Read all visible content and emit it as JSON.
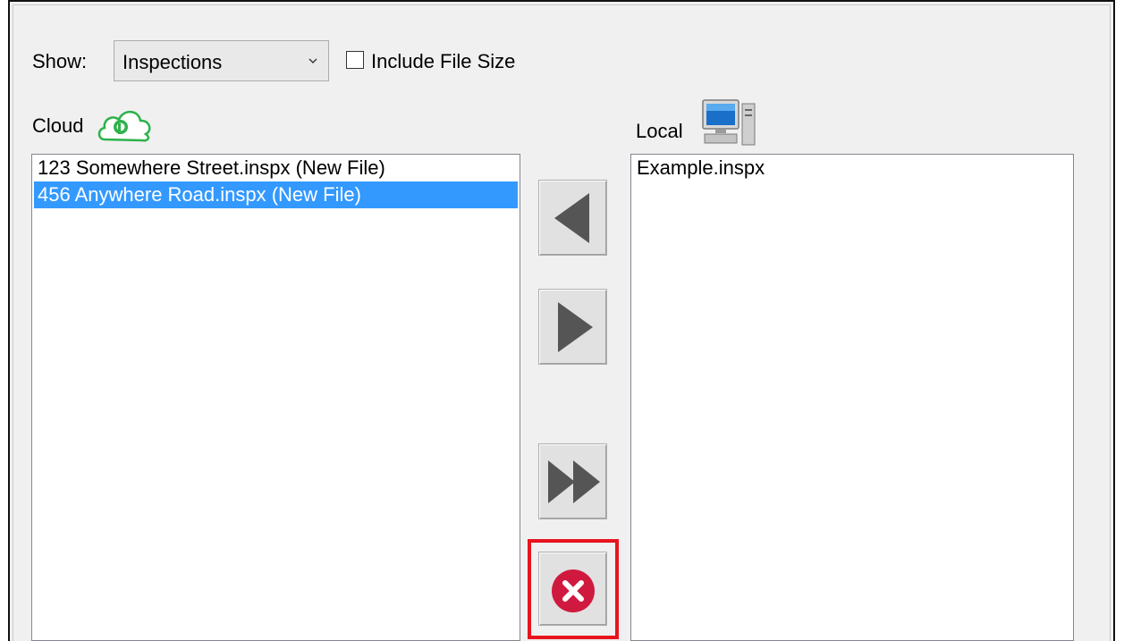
{
  "toolbar": {
    "show_label": "Show:",
    "show_select": {
      "selected": "Inspections"
    },
    "include_file_size": {
      "label": "Include File Size",
      "checked": false
    }
  },
  "cloud": {
    "label": "Cloud",
    "icon": "cloud-icon",
    "files": [
      {
        "name": "123 Somewhere Street.inspx (New File)",
        "selected": false
      },
      {
        "name": "456 Anywhere Road.inspx (New File)",
        "selected": true
      }
    ]
  },
  "local": {
    "label": "Local",
    "icon": "computer-icon",
    "files": [
      {
        "name": "Example.inspx",
        "selected": false
      }
    ]
  },
  "transfer_buttons": [
    {
      "name": "download-button",
      "icon": "arrow-left-icon"
    },
    {
      "name": "upload-button",
      "icon": "arrow-right-icon"
    },
    {
      "name": "upload-all-button",
      "icon": "double-arrow-right-icon"
    },
    {
      "name": "delete-button",
      "icon": "delete-x-icon"
    }
  ],
  "colors": {
    "selection": "#3399ff",
    "highlight_border": "#e8141e",
    "delete_icon": "#d0193f",
    "cloud_icon": "#2db24a"
  }
}
